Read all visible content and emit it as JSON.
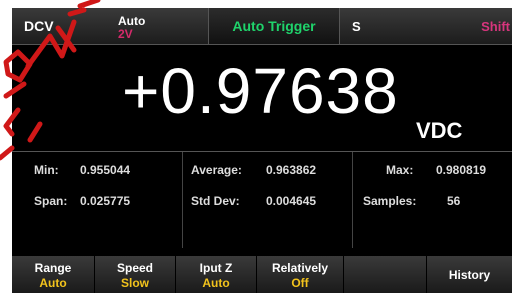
{
  "topbar": {
    "mode": "DCV",
    "range_mode": "Auto",
    "range_value": "2V",
    "trigger": "Auto Trigger",
    "speed_indicator": "S",
    "shift": "Shift"
  },
  "display": {
    "reading": "+0.97638",
    "unit": "VDC"
  },
  "stats": {
    "min_label": "Min:",
    "min_value": "0.955044",
    "span_label": "Span:",
    "span_value": "0.025775",
    "average_label": "Average:",
    "average_value": "0.963862",
    "stddev_label": "Std Dev:",
    "stddev_value": "0.004645",
    "max_label": "Max:",
    "max_value": "0.980819",
    "samples_label": "Samples:",
    "samples_value": "56"
  },
  "softkeys": [
    {
      "label": "Range",
      "value": "Auto"
    },
    {
      "label": "Speed",
      "value": "Slow"
    },
    {
      "label": "Iput Z",
      "value": "Auto"
    },
    {
      "label": "Relatively",
      "value": "Off"
    },
    {
      "label": "",
      "value": ""
    },
    {
      "label": "History",
      "value": ""
    }
  ],
  "colors": {
    "background": "#000000",
    "trigger_green": "#1fd36b",
    "shift_pink": "#d7357d",
    "softkey_value_yellow": "#f2c31c",
    "watermark_red": "#d01818"
  }
}
